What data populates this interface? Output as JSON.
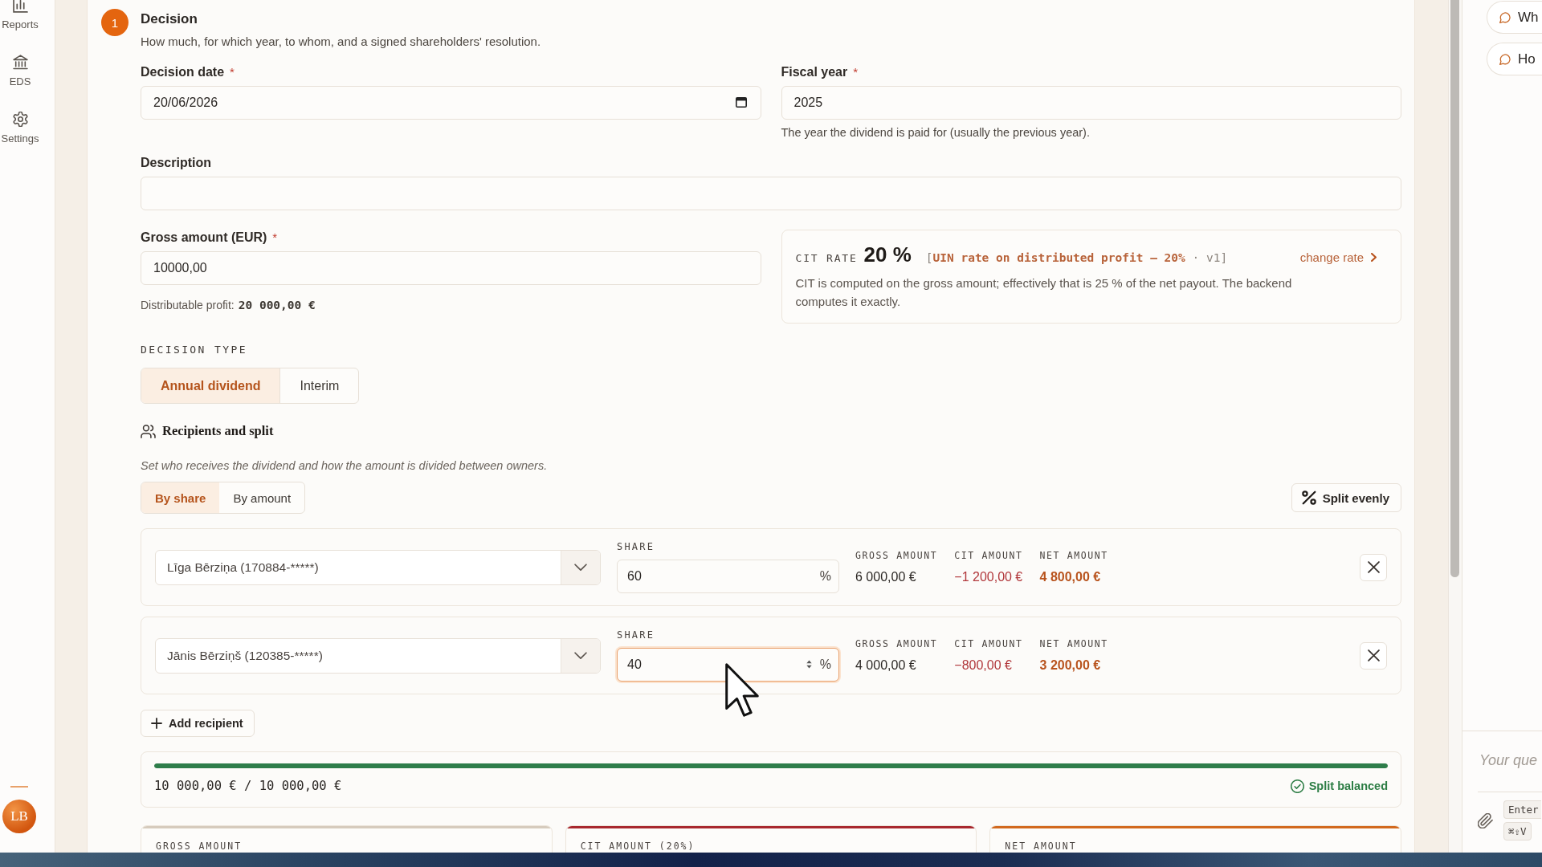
{
  "sidebar": {
    "items": [
      {
        "label": "Reports",
        "selected": false
      },
      {
        "label": "EDS",
        "selected": false
      },
      {
        "label": "Settings",
        "selected": false
      }
    ],
    "user": {
      "initials": "LB"
    }
  },
  "step": {
    "number": "1",
    "title": "Decision",
    "subtitle": "How much, for which year, to whom, and a signed shareholders' resolution."
  },
  "decision_date": {
    "label": "Decision date",
    "required_mark": "*",
    "value": "20/06/2026"
  },
  "fiscal_year": {
    "label": "Fiscal year",
    "required_mark": "*",
    "value": "2025",
    "hint": "The year the dividend is paid for (usually the previous year)."
  },
  "description": {
    "label": "Description"
  },
  "gross_amount": {
    "label": "Gross amount (EUR)",
    "required_mark": "*",
    "value": "10000,00",
    "hint_label": "Distributable profit:",
    "hint_value": "20 000,00 €"
  },
  "cit_rate": {
    "label": "CIT RATE",
    "value": "20 %",
    "source": "[**UIN rate on distributed profit — 20%** · v1]",
    "link": "change rate",
    "note": "CIT is computed on the gross amount; effectively that is 25 % of the net payout. The backend computes it exactly."
  },
  "decision_type": {
    "label": "DECISION TYPE",
    "options": [
      {
        "label": "Annual dividend",
        "selected": true
      },
      {
        "label": "Interim",
        "selected": false
      }
    ]
  },
  "recipients": {
    "title": "Recipients and split",
    "description": "Set who receives the dividend and how the amount is divided between owners.",
    "modes": [
      {
        "label": "By share",
        "selected": true
      },
      {
        "label": "By amount",
        "selected": false
      }
    ],
    "split_button": "Split evenly",
    "rows": [
      {
        "person": "Līga Bērziņa (170884-*****)",
        "share_label": "SHARE",
        "share": "60",
        "unit": "%",
        "focused": false,
        "gross_label": "GROSS AMOUNT",
        "gross": "6 000,00 €",
        "cit_label": "CIT AMOUNT",
        "cit": "−1 200,00 €",
        "net_label": "NET AMOUNT",
        "net": "4 800,00 €"
      },
      {
        "person": "Jānis Bērziņš (120385-*****)",
        "share_label": "SHARE",
        "share": "40",
        "unit": "%",
        "focused": true,
        "gross_label": "GROSS AMOUNT",
        "gross": "4 000,00 €",
        "cit_label": "CIT AMOUNT",
        "cit": "−800,00 €",
        "net_label": "NET AMOUNT",
        "net": "3 200,00 €"
      }
    ],
    "add_button": "Add recipient"
  },
  "balance": {
    "level": 1,
    "text": "10 000,00 € / 10 000,00 €",
    "status": "Split balanced",
    "balanced": true
  },
  "summary": [
    {
      "label": "GROSS AMOUNT",
      "color": "#d6cbbd"
    },
    {
      "label": "CIT AMOUNT (20%)",
      "color": "#a8282e"
    },
    {
      "label": "NET AMOUNT",
      "color": "#d2691e"
    }
  ],
  "assistant": {
    "suggestions": [
      {
        "text": "Wh"
      },
      {
        "text": "Ho"
      }
    ],
    "placeholder": "Your que",
    "shortcuts": [
      "Enter",
      "⌘⇧V"
    ]
  }
}
